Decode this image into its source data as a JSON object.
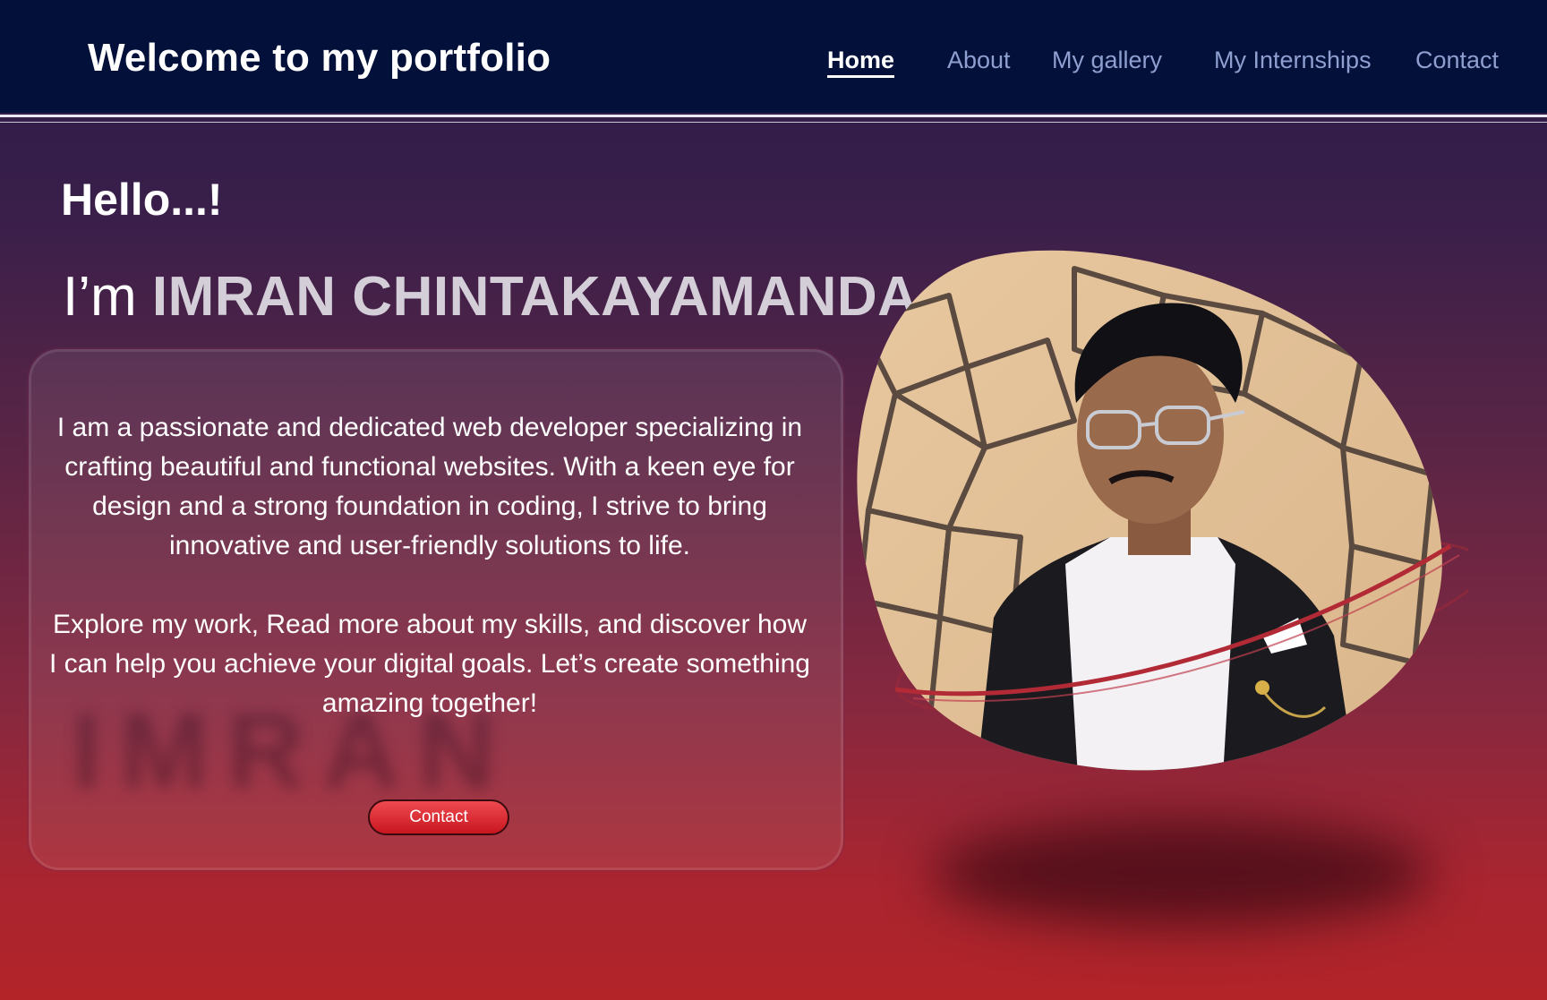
{
  "header": {
    "title": "Welcome to my portfolio",
    "nav": [
      {
        "label": "Home",
        "active": true
      },
      {
        "label": "About",
        "active": false
      },
      {
        "label": "My gallery",
        "active": false
      },
      {
        "label": "My Internships",
        "active": false
      },
      {
        "label": "Contact",
        "active": false
      }
    ]
  },
  "hero": {
    "greeting": "Hello...!",
    "intro_prefix": "I’m ",
    "name": "IMRAN CHINTAKAYAMANDA",
    "intro_suffix": ",",
    "paragraph1": "I am a passionate and dedicated web developer specializing in crafting beautiful and functional websites. With a keen eye for design and a strong foundation in coding, I strive to bring innovative and user-friendly solutions to life.",
    "paragraph2": "Explore my work, Read more about my skills, and discover how I can help you achieve your digital goals. Let’s create something amazing together!",
    "contact_button": "Contact"
  },
  "colors": {
    "navbar": "#03103a",
    "nav_link": "#8e9fd0",
    "accent_red": "#c8161f"
  },
  "icons": {
    "profile_photo": "portrait-photo"
  }
}
